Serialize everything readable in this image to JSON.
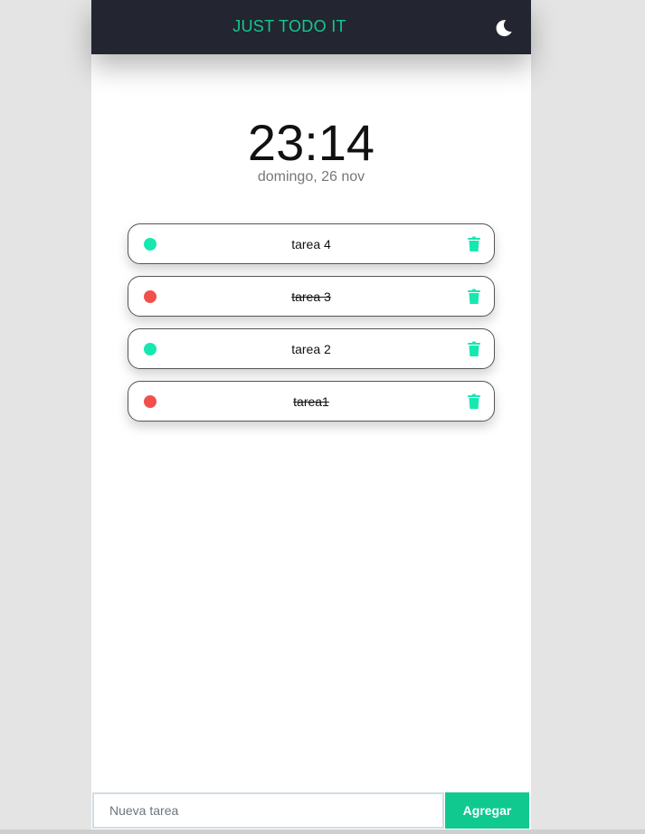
{
  "header": {
    "title": "JUST TODO IT",
    "theme_icon": "moon-icon"
  },
  "clock": {
    "time": "23:14",
    "date": "domingo, 26 nov"
  },
  "tasks": [
    {
      "label": "tarea 4",
      "done": false
    },
    {
      "label": "tarea 3",
      "done": true
    },
    {
      "label": "tarea 2",
      "done": false
    },
    {
      "label": "tarea1",
      "done": true
    }
  ],
  "new_task": {
    "placeholder": "Nueva tarea",
    "value": "",
    "add_label": "Agregar"
  },
  "colors": {
    "accent": "#10c98f",
    "pending": "#17e8b0",
    "done": "#f2504b",
    "header_bg": "#232530"
  }
}
